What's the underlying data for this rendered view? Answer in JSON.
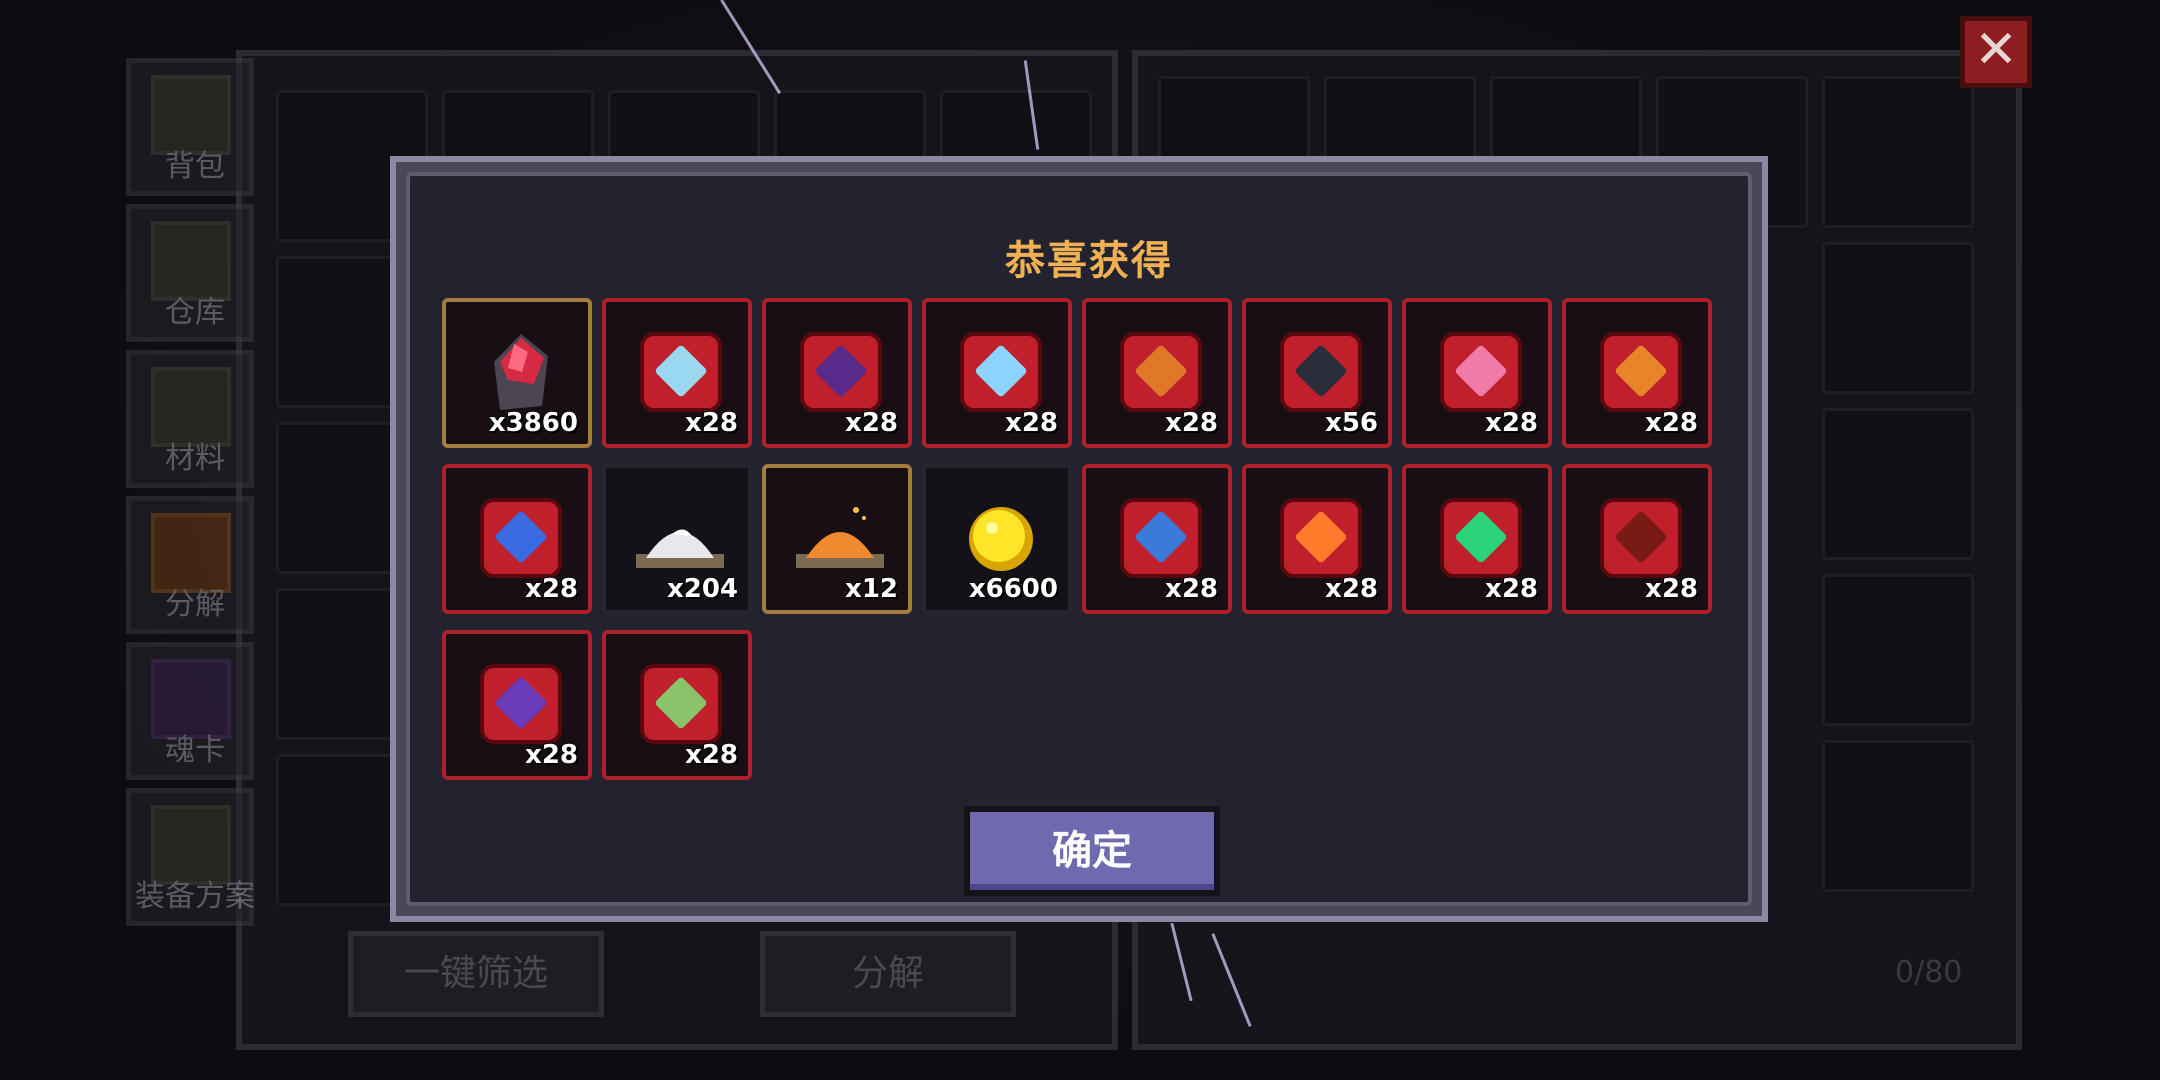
{
  "sidebar": {
    "items": [
      {
        "label": "背包",
        "icon": "backpack-icon"
      },
      {
        "label": "仓库",
        "icon": "chest-icon"
      },
      {
        "label": "材料",
        "icon": "materials-icon"
      },
      {
        "label": "分解",
        "icon": "decompose-icon"
      },
      {
        "label": "魂卡",
        "icon": "soul-card-icon"
      },
      {
        "label": "装备方案",
        "icon": "equipment-preset-icon"
      }
    ]
  },
  "bottom_buttons": {
    "filter_label": "一键筛选",
    "decompose_label": "分解"
  },
  "inventory_counter": "0/80",
  "close_label": "✕",
  "modal": {
    "title": "恭喜获得",
    "confirm_label": "确定",
    "rewards": [
      {
        "name": "red-crystal-icon",
        "count": "x3860"
      },
      {
        "name": "ice-axe-icon",
        "count": "x28"
      },
      {
        "name": "purple-gun-icon",
        "count": "x28"
      },
      {
        "name": "blue-orb-icon",
        "count": "x28"
      },
      {
        "name": "fire-staff-icon",
        "count": "x28"
      },
      {
        "name": "dark-crossbow-icon",
        "count": "x56"
      },
      {
        "name": "pink-scythe-icon",
        "count": "x28"
      },
      {
        "name": "flame-shield-icon",
        "count": "x28"
      },
      {
        "name": "blue-bow-icon",
        "count": "x28"
      },
      {
        "name": "silver-dust-icon",
        "count": "x204"
      },
      {
        "name": "orange-dust-icon",
        "count": "x12"
      },
      {
        "name": "gold-coin-icon",
        "count": "x6600"
      },
      {
        "name": "blue-sword-icon",
        "count": "x28"
      },
      {
        "name": "fire-crown-icon",
        "count": "x28"
      },
      {
        "name": "green-staff-icon",
        "count": "x28"
      },
      {
        "name": "red-blade-icon",
        "count": "x28"
      },
      {
        "name": "violet-pickaxe-icon",
        "count": "x28"
      },
      {
        "name": "green-hammer-icon",
        "count": "x28"
      }
    ]
  }
}
